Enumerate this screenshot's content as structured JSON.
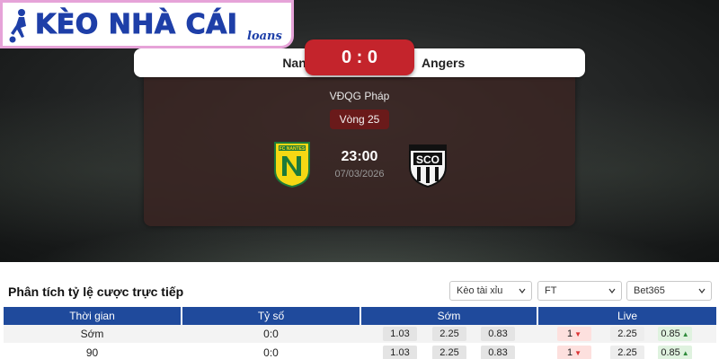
{
  "brand": {
    "name": "KÈO NHÀ CÁI",
    "sub": "loans",
    "accent": "#1e3fa8",
    "border": "#e6a3d8"
  },
  "match": {
    "home_team": "Nantes",
    "away_team": "Angers",
    "score": "0 : 0",
    "league": "VĐQG Pháp",
    "round": "Vòng 25",
    "kickoff_time": "23:00",
    "date": "07/03/2026",
    "home_crest": {
      "icon": "fc-nantes-crest-icon",
      "text": "FC NANTES",
      "color": "#f5d814"
    },
    "away_crest": {
      "icon": "sco-angers-crest-icon",
      "text": "SCO"
    },
    "score_color": "#c4242c"
  },
  "odds_section": {
    "title": "Phân tích tỷ lệ cược trực tiếp",
    "filters": {
      "market": "Kèo tài xỉu",
      "period": "FT",
      "bookmaker": "Bet365"
    },
    "columns": [
      "Thời gian",
      "Tỷ số",
      "Sớm",
      "Live"
    ],
    "header_color": "#1f4a9c",
    "rows": [
      {
        "time": "Sớm",
        "score": "0:0",
        "early": [
          "1.03",
          "2.25",
          "0.83"
        ],
        "live": [
          "1",
          "2.25",
          "0.85"
        ]
      },
      {
        "time": "90",
        "score": "0:0",
        "early": [
          "1.03",
          "2.25",
          "0.83"
        ],
        "live": [
          "1",
          "2.25",
          "0.85"
        ]
      }
    ]
  }
}
